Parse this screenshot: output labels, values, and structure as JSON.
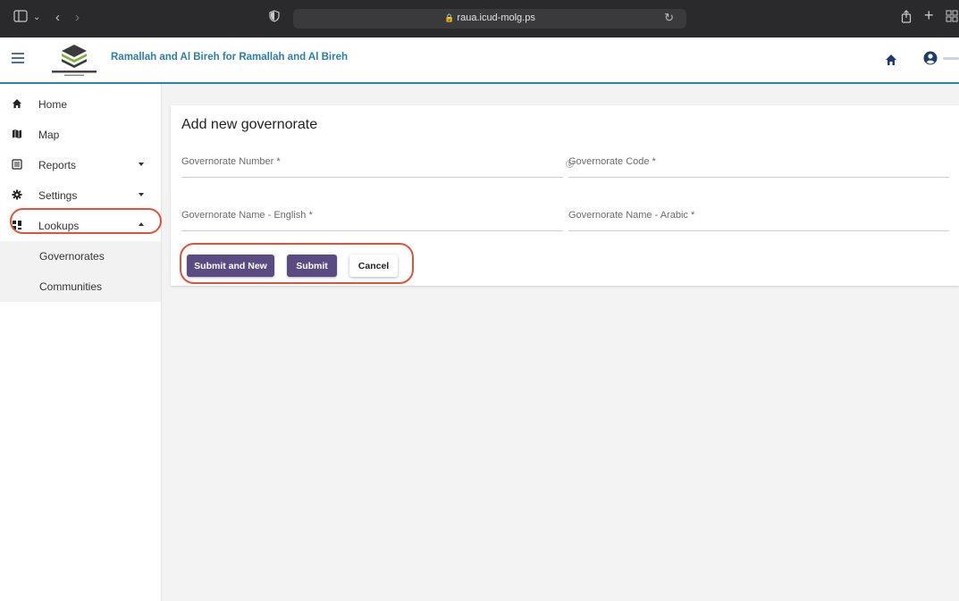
{
  "browser": {
    "url": "raua.icud-molg.ps",
    "icons": [
      "sidebar-toggle-icon",
      "chevron-down-icon",
      "back-icon",
      "forward-icon",
      "privacy-shield-icon",
      "lock-icon",
      "reload-icon",
      "share-icon",
      "new-tab-icon",
      "tab-overview-icon"
    ]
  },
  "header": {
    "title": "Ramallah and Al Bireh for Ramallah and Al Bireh",
    "accent_color": "#2a7fae",
    "icons": [
      "menu-icon",
      "logo",
      "home-icon",
      "user-icon"
    ]
  },
  "sidebar": {
    "items": [
      {
        "label": "Home",
        "icon": "home-icon"
      },
      {
        "label": "Map",
        "icon": "map-icon"
      },
      {
        "label": "Reports",
        "icon": "reports-icon",
        "state": "collapsed"
      },
      {
        "label": "Settings",
        "icon": "gear-icon",
        "state": "collapsed"
      },
      {
        "label": "Lookups",
        "icon": "lookups-icon",
        "state": "expanded",
        "highlighted": true
      }
    ],
    "sub_items": [
      {
        "label": "Governorates"
      },
      {
        "label": "Communities"
      }
    ],
    "highlight_color": "#e0533a"
  },
  "form": {
    "title": "Add new governorate",
    "fields": {
      "number": {
        "placeholder": "Governorate Number *",
        "value": ""
      },
      "code": {
        "placeholder": "Governorate Code *",
        "value": ""
      },
      "name_en": {
        "placeholder": "Governorate Name - English *",
        "value": ""
      },
      "name_ar": {
        "placeholder": "Governorate Name - Arabic *",
        "value": ""
      }
    },
    "buttons": {
      "submit_new": "Submit and New",
      "submit": "Submit",
      "cancel": "Cancel"
    },
    "primary_color": "#5a4b82"
  }
}
